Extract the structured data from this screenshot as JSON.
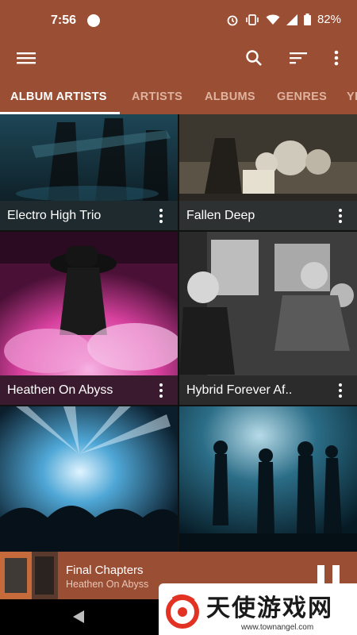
{
  "status_bar": {
    "time": "7:56",
    "battery": "82%",
    "icons": [
      "alarm-icon",
      "vibrate-icon",
      "wifi-icon",
      "signal-icon",
      "battery-icon"
    ]
  },
  "app_bar": {
    "icons": [
      "menu-icon",
      "search-icon",
      "sort-icon",
      "more-vert-icon"
    ]
  },
  "tabs": [
    {
      "label": "ALBUM ARTISTS",
      "active": true
    },
    {
      "label": "ARTISTS",
      "active": false
    },
    {
      "label": "ALBUMS",
      "active": false
    },
    {
      "label": "GENRES",
      "active": false
    },
    {
      "label": "YE",
      "active": false
    }
  ],
  "artists": [
    {
      "name": "Electro High Trio"
    },
    {
      "name": "Fallen Deep"
    },
    {
      "name": "Heathen On Abyss"
    },
    {
      "name": "Hybrid Forever Af.."
    },
    {
      "name": ""
    },
    {
      "name": ""
    }
  ],
  "now_playing": {
    "title": "Final Chapters",
    "artist": "Heathen On Abyss",
    "state_icon": "pause-icon"
  },
  "watermark": {
    "text": "天使游戏网",
    "url": "www.townangel.com"
  },
  "colors": {
    "primary": "#9a4e33",
    "tab_inactive": "#dfb39f",
    "caption_bg": "#1f2a2e"
  }
}
